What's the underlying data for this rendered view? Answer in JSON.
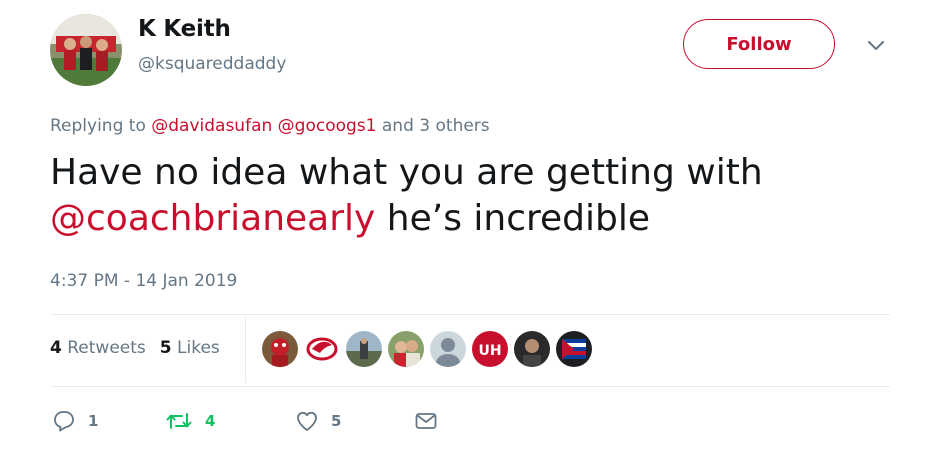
{
  "author": {
    "name": "K Keith",
    "handle": "@ksquareddaddy"
  },
  "follow_label": "Follow",
  "reply_context": {
    "prefix": "Replying to",
    "mentions": [
      "@davidasufan",
      "@gocoogs1"
    ],
    "suffix": "and 3 others"
  },
  "tweet": {
    "line1": "Have no idea what you are getting with",
    "mention": "@coachbrianearly",
    "line2_rest": " he’s incredible"
  },
  "timestamp": "4:37 PM - 14 Jan 2019",
  "stats": {
    "retweets_count": "4",
    "retweets_label": "Retweets",
    "likes_count": "5",
    "likes_label": "Likes"
  },
  "actions": {
    "reply_count": "1",
    "retweet_count": "4",
    "like_count": "5"
  },
  "colors": {
    "accent": "#c8102e",
    "retweet_active": "#17bf63",
    "muted": "#657786"
  },
  "icons": [
    "chevron-down-icon",
    "reply-icon",
    "retweet-icon",
    "like-icon",
    "direct-message-icon"
  ]
}
